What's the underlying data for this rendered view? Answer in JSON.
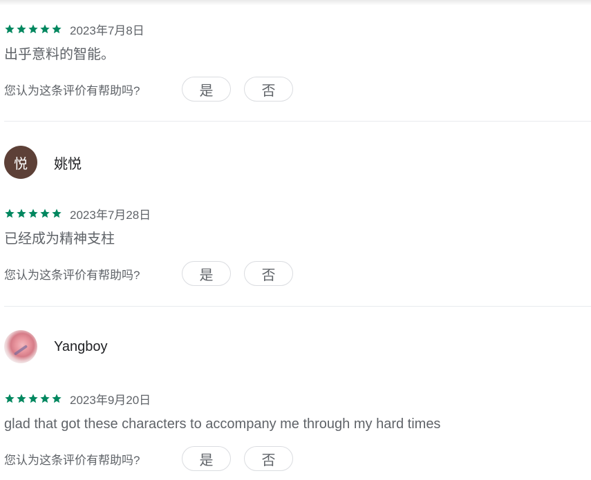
{
  "reviews": [
    {
      "stars": 5,
      "date": "2023年7月8日",
      "text": "出乎意料的智能。",
      "helpful_question": "您认为这条评价有帮助吗?",
      "yes_label": "是",
      "no_label": "否"
    },
    {
      "author": "姚悦",
      "avatar_letter": "悦",
      "avatar_color": "#5d4037",
      "stars": 5,
      "date": "2023年7月28日",
      "text": "已经成为精神支柱",
      "helpful_question": "您认为这条评价有帮助吗?",
      "yes_label": "是",
      "no_label": "否"
    },
    {
      "author": "Yangboy",
      "avatar_type": "photo",
      "stars": 5,
      "date": "2023年9月20日",
      "text": "glad that got these characters to accompany me through my hard times",
      "helpful_question": "您认为这条评价有帮助吗?",
      "yes_label": "是",
      "no_label": "否"
    }
  ],
  "colors": {
    "star": "#01875f",
    "divider": "#e8eaed"
  },
  "icons": {
    "star": "star-icon"
  }
}
